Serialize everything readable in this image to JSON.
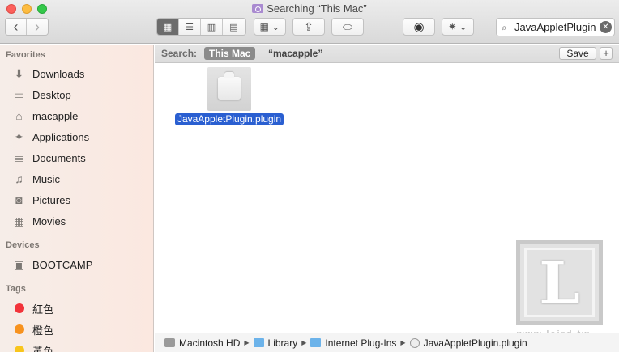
{
  "window": {
    "title": "Searching “This Mac”"
  },
  "toolbar": {
    "back_icon": "‹",
    "forward_icon": "›",
    "view_icons": [
      "▦",
      "☰",
      "▥",
      "▤"
    ],
    "arrange_icon": "▦ ⌄",
    "share_icon": "⇪",
    "tag_icon": "⬭",
    "quicklook_icon": "◉",
    "action_icon": "✷ ⌄"
  },
  "search": {
    "value": "JavaAppletPlugin",
    "mag_icon": "⌕",
    "clear_icon": "✕"
  },
  "sidebar": {
    "favorites_header": "Favorites",
    "favorites": [
      {
        "label": "Downloads",
        "icon": "⬇"
      },
      {
        "label": "Desktop",
        "icon": "▭"
      },
      {
        "label": "macapple",
        "icon": "⌂"
      },
      {
        "label": "Applications",
        "icon": "✦"
      },
      {
        "label": "Documents",
        "icon": "▤"
      },
      {
        "label": "Music",
        "icon": "♫"
      },
      {
        "label": "Pictures",
        "icon": "◙"
      },
      {
        "label": "Movies",
        "icon": "▦"
      }
    ],
    "devices_header": "Devices",
    "devices": [
      {
        "label": "BOOTCAMP",
        "icon": "▣"
      }
    ],
    "tags_header": "Tags",
    "tags": [
      {
        "label": "紅色",
        "color": "#f2333a"
      },
      {
        "label": "橙色",
        "color": "#f7921e"
      },
      {
        "label": "黃色",
        "color": "#f8c51c"
      }
    ]
  },
  "scope_bar": {
    "label": "Search:",
    "this_mac": "This Mac",
    "user_scope": "“macapple”",
    "save_label": "Save",
    "plus_label": "+"
  },
  "results": [
    {
      "name": "JavaAppletPlugin.plugin"
    }
  ],
  "watermark": {
    "letter": "L",
    "text": "www.laird.tw"
  },
  "path_bar": {
    "items": [
      "Macintosh HD",
      "Library",
      "Internet Plug-Ins",
      "JavaAppletPlugin.plugin"
    ],
    "separator": "▶"
  }
}
